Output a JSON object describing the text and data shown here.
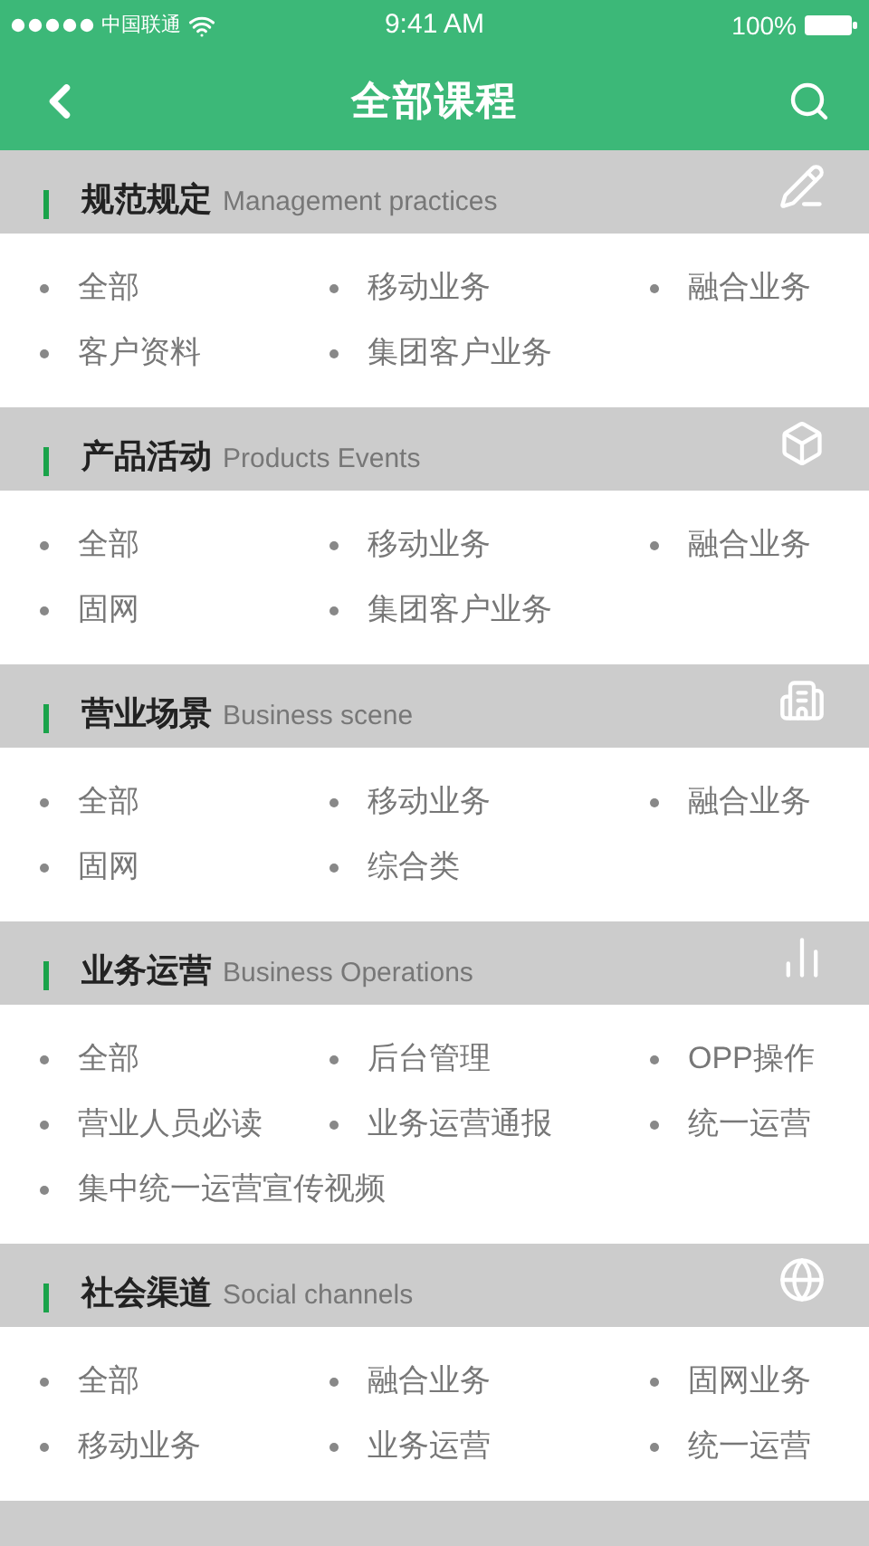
{
  "status_bar": {
    "carrier": "中国联通",
    "time": "9:41 AM",
    "battery": "100%"
  },
  "nav": {
    "title": "全部课程"
  },
  "sections": [
    {
      "title": "规范规定",
      "subtitle": "Management practices",
      "kind": "pencil",
      "items": [
        "全部",
        "移动业务",
        "融合业务",
        "客户资料",
        "集团客户业务"
      ]
    },
    {
      "title": "产品活动",
      "subtitle": "Products Events",
      "kind": "cube",
      "items": [
        "全部",
        "移动业务",
        "融合业务",
        "固网",
        "集团客户业务"
      ]
    },
    {
      "title": "营业场景",
      "subtitle": "Business scene",
      "kind": "building",
      "items": [
        "全部",
        "移动业务",
        "融合业务",
        "固网",
        "综合类"
      ]
    },
    {
      "title": "业务运营",
      "subtitle": "Business Operations",
      "kind": "chart",
      "items": [
        "全部",
        "后台管理",
        "OPP操作",
        "营业人员必读",
        "业务运营通报",
        "统一运营",
        "集中统一运营宣传视频"
      ]
    },
    {
      "title": "社会渠道",
      "subtitle": "Social channels",
      "kind": "globe",
      "items": [
        "全部",
        "融合业务",
        "固网业务",
        "移动业务",
        "业务运营",
        "统一运营"
      ]
    }
  ]
}
